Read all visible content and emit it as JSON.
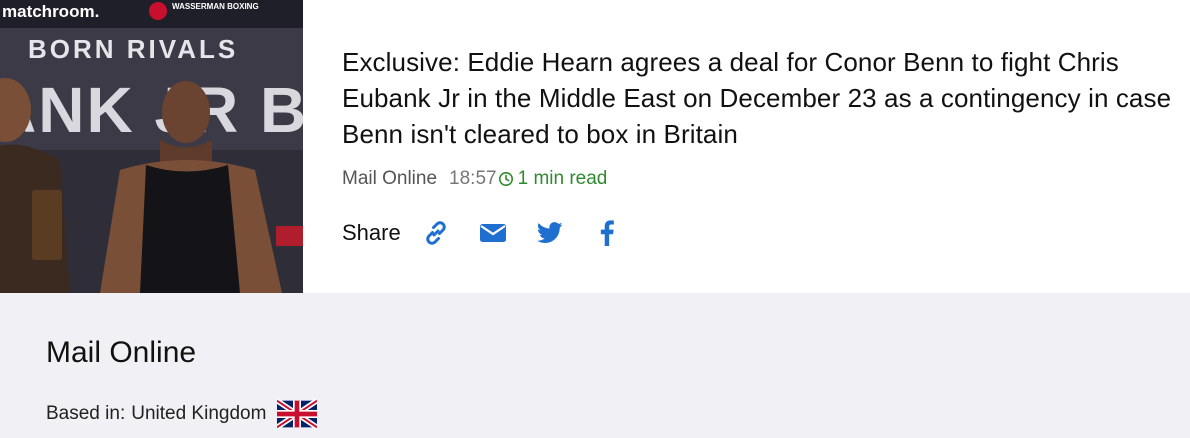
{
  "article": {
    "image_text": {
      "brand": "matchroom.",
      "partner": "WASSERMAN BOXING",
      "event": "BORN RIVALS",
      "names": "ANK JR BEN"
    },
    "headline": "Exclusive: Eddie Hearn agrees a deal for Conor Benn to fight Chris Eubank Jr in the Middle East on December 23 as a contingency in case Benn isn't cleared to box in Britain",
    "source": "Mail Online",
    "time": "18:57",
    "read_time": "1 min read",
    "share": {
      "label": "Share",
      "buttons": [
        {
          "icon": "link-icon"
        },
        {
          "icon": "email-icon"
        },
        {
          "icon": "twitter-icon"
        },
        {
          "icon": "facebook-icon"
        }
      ]
    }
  },
  "source_panel": {
    "name": "Mail Online",
    "based_in_label": "Based in:",
    "country": "United Kingdom",
    "flag_icon": "uk-flag-icon"
  },
  "colors": {
    "accent_blue": "#1e6fd0",
    "read_time_green": "#2e8b2e",
    "panel_bg": "#f1f0f4"
  }
}
